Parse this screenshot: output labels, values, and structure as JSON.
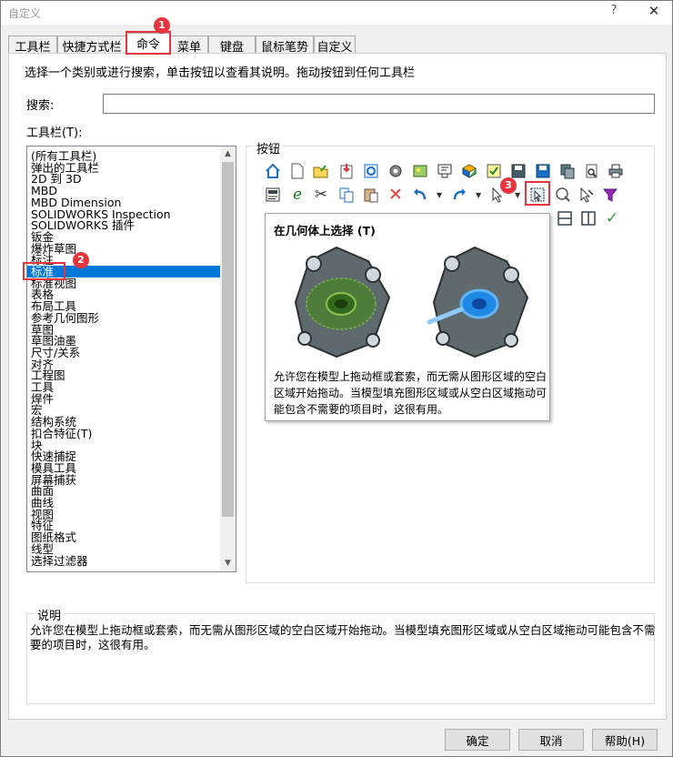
{
  "window": {
    "title": "自定义",
    "help_glyph": "?",
    "close_glyph": "✕"
  },
  "tabs": [
    "工具栏",
    "快捷方式栏",
    "命令",
    "菜单",
    "键盘",
    "鼠标笔势",
    "自定义"
  ],
  "instructions": "选择一个类别或进行搜索，单击按钮以查看其说明。拖动按钮到任何工具栏",
  "search": {
    "label": "搜索:",
    "value": ""
  },
  "toolbar_list": {
    "label": "工具栏(T):",
    "items": [
      "(所有工具栏)",
      "弹出的工具栏",
      "2D 到 3D",
      "MBD",
      "MBD Dimension",
      "SOLIDWORKS Inspection",
      "SOLIDWORKS 插件",
      "钣金",
      "爆炸草图",
      "标注",
      "标准",
      "标准视图",
      "表格",
      "布局工具",
      "参考几何图形",
      "草图",
      "草图油墨",
      "尺寸/关系",
      "对齐",
      "工程图",
      "工具",
      "焊件",
      "宏",
      "结构系统",
      "扣合特征(T)",
      "块",
      "快速捕捉",
      "模具工具",
      "屏幕捕获",
      "曲面",
      "曲线",
      "视图",
      "特征",
      "图纸格式",
      "线型",
      "选择过滤器"
    ],
    "selected": "标准"
  },
  "buttons_group": {
    "title": "按钮",
    "row1": [
      "home-icon",
      "new-document-icon",
      "open-icon",
      "import-icon",
      "rebuild-icon",
      "options-icon",
      "photo-icon",
      "print-preview-icon",
      "material-icon",
      "checklist-icon",
      "save-icon",
      "save-as-icon",
      "copy-drawing-icon",
      "zoom-document-icon",
      "print-icon"
    ],
    "row2": [
      "properties-icon",
      "edge-icon",
      "cut-icon",
      "copy-icon",
      "paste-icon",
      "delete-icon",
      "undo-icon",
      "redo-icon",
      "select-icon",
      "select-geometry-icon",
      "magic-select-icon",
      "select-chain-icon",
      "selection-filter-icon"
    ]
  },
  "tooltip": {
    "title": "在几何体上选择   (T)",
    "text": "允许您在模型上拖动框或套索，而无需从图形区域的空白区域开始拖动。当模型填充图形区域或从空白区域拖动可能包含不需要的项目时，这很有用。"
  },
  "badges": [
    "1",
    "2",
    "3"
  ],
  "description": {
    "title": "说明",
    "text": "允许您在模型上拖动框或套索，而无需从图形区域的空白区域开始拖动。当模型填充图形区域或从空白区域拖动可能包含不需要的项目时，这很有用。"
  },
  "footer": {
    "ok": "确定",
    "cancel": "取消",
    "help": "帮助(H)"
  },
  "colors": {
    "accent": "#0078d7",
    "highlight": "#e8343c"
  }
}
